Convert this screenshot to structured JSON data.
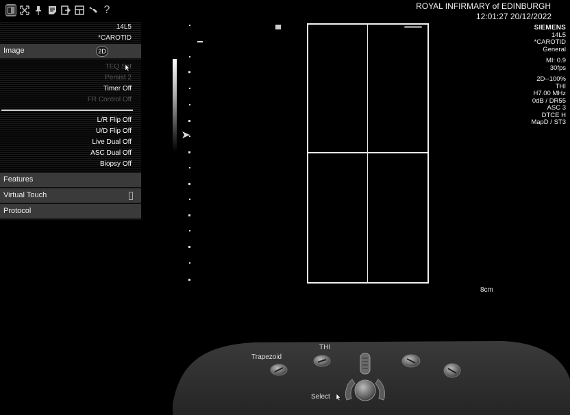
{
  "header": {
    "institution": "ROYAL INFIRMARY of EDINBURGH",
    "datetime": "12:01:27 20/12/2022"
  },
  "toolbar": {
    "icons": [
      "split-view-icon",
      "expand-icon",
      "pin-icon",
      "notes-icon",
      "export-icon",
      "layout-icon",
      "wrench-icon",
      "help-icon"
    ],
    "help_glyph": "?"
  },
  "panel": {
    "transducer": "14L5",
    "preset": "*CAROTID",
    "image_menu": {
      "label": "Image",
      "mode_badge": "2D"
    },
    "options_top": [
      {
        "label": "TEQ Set",
        "dim": true
      },
      {
        "label": "Persist 2",
        "dim": true
      },
      {
        "label": "Timer Off",
        "dim": false
      },
      {
        "label": "FR Control Off",
        "dim": true
      }
    ],
    "options_bottom": [
      {
        "label": "L/R Flip Off"
      },
      {
        "label": "U/D Flip Off"
      },
      {
        "label": "Live Dual Off"
      },
      {
        "label": "ASC Dual Off"
      },
      {
        "label": "Biopsy Off"
      }
    ],
    "features_label": "Features",
    "virtual_touch_label": "Virtual Touch",
    "protocol_label": "Protocol"
  },
  "image": {
    "marker": "■",
    "depth": "8cm"
  },
  "info": {
    "brand": "SIEMENS",
    "transducer": "14L5",
    "preset": "*CAROTID",
    "app": "General",
    "mi": "MI: 0.9",
    "fps": "30fps",
    "mode": "2D--100%",
    "thi": "THI",
    "freq": "H7.00 MHz",
    "gain": "0dB / DR55",
    "asc": "ASC 3",
    "dtce": "DTCE H",
    "map": "MapD / ST3"
  },
  "console": {
    "trapezoid_label": "Trapezoid",
    "thi_label": "THI",
    "select_label": "Select"
  }
}
